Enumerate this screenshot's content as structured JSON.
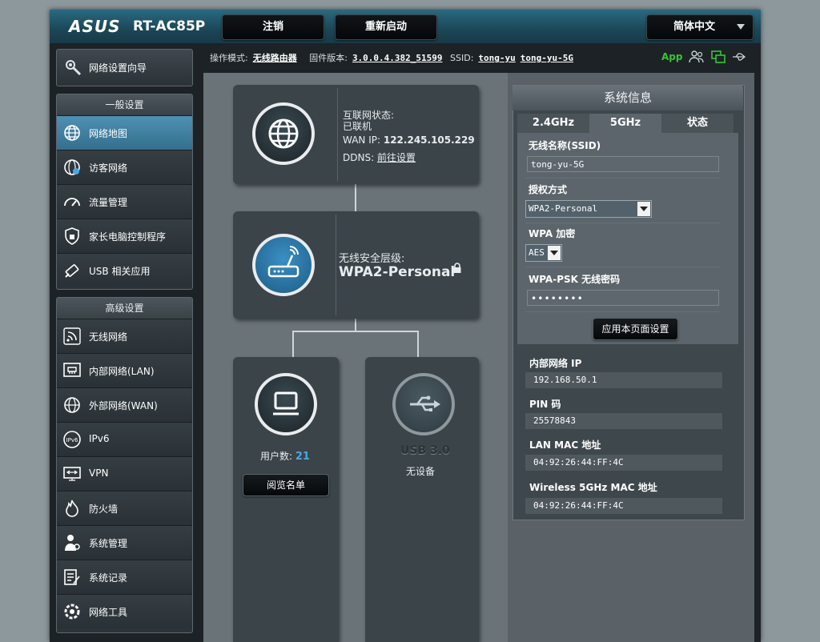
{
  "header": {
    "brand": "ASUS",
    "model": "RT-AC85P",
    "logout_label": "注销",
    "reboot_label": "重新启动",
    "language": "简体中文"
  },
  "statusbar": {
    "mode_label": "操作模式:",
    "mode_value": "无线路由器",
    "firmware_label": "固件版本:",
    "firmware_value": "3.0.0.4.382_51599",
    "ssid_label": "SSID:",
    "ssid_1": "tong-yu",
    "ssid_2": "tong-yu-5G",
    "app_label": "App"
  },
  "sidebar": {
    "wizard": {
      "label": "网络设置向导",
      "icon": "wizard-icon"
    },
    "general_title": "一般设置",
    "general_items": [
      {
        "label": "网络地图",
        "icon": "globe-icon",
        "active": true
      },
      {
        "label": "访客网络",
        "icon": "guest-network-icon"
      },
      {
        "label": "流量管理",
        "icon": "gauge-icon"
      },
      {
        "label": "家长电脑控制程序",
        "icon": "parental-shield-icon"
      },
      {
        "label": "USB 相关应用",
        "icon": "usb-app-icon"
      }
    ],
    "advanced_title": "高级设置",
    "advanced_items": [
      {
        "label": "无线网络",
        "icon": "wireless-icon"
      },
      {
        "label": "内部网络(LAN)",
        "icon": "lan-icon"
      },
      {
        "label": "外部网络(WAN)",
        "icon": "wan-globe-icon"
      },
      {
        "label": "IPv6",
        "icon": "ipv6-icon"
      },
      {
        "label": "VPN",
        "icon": "vpn-icon"
      },
      {
        "label": "防火墙",
        "icon": "firewall-icon"
      },
      {
        "label": "系统管理",
        "icon": "admin-icon"
      },
      {
        "label": "系统记录",
        "icon": "log-icon"
      },
      {
        "label": "网络工具",
        "icon": "network-tools-icon"
      }
    ]
  },
  "map": {
    "internet": {
      "status_label": "互联网状态:",
      "status_value": "已联机",
      "wan_ip_label": "WAN IP:",
      "wan_ip_value": "122.245.105.229",
      "ddns_label": "DDNS:",
      "ddns_link": "前往设置"
    },
    "router": {
      "security_label": "无线安全层级:",
      "security_value": "WPA2-Personal"
    },
    "clients": {
      "count_label": "用户数:",
      "count_value": "21",
      "view_list_label": "阅览名单"
    },
    "usb": {
      "title": "USB 3.0",
      "status": "无设备"
    }
  },
  "sysinfo": {
    "title": "系统信息",
    "tabs": [
      "2.4GHz",
      "5GHz",
      "状态"
    ],
    "ssid_label": "无线名称(SSID)",
    "ssid_value": "tong-yu-5G",
    "auth_label": "授权方式",
    "auth_value": "WPA2-Personal",
    "wpa_label": "WPA 加密",
    "wpa_value": "AES",
    "psk_label": "WPA-PSK 无线密码",
    "psk_value": "••••••••",
    "apply_label": "应用本页面设置",
    "lan_ip_label": "内部网络 IP",
    "lan_ip_value": "192.168.50.1",
    "pin_label": "PIN 码",
    "pin_value": "25578843",
    "lan_mac_label": "LAN MAC 地址",
    "lan_mac_value": "04:92:26:44:FF:4C",
    "wl5g_mac_label": "Wireless 5GHz MAC 地址",
    "wl5g_mac_value": "04:92:26:44:FF:4C"
  },
  "colors": {
    "accent_blue": "#3d86ad",
    "app_green": "#34c633",
    "client_count_blue": "#4aa8e0"
  }
}
